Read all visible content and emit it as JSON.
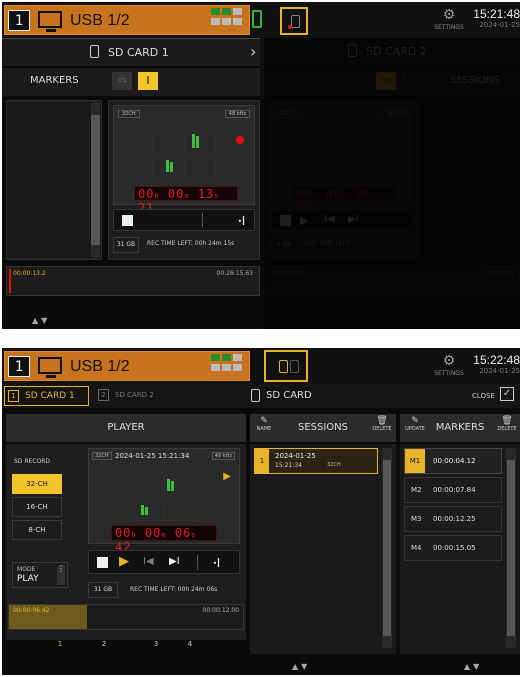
{
  "colors": {
    "accent": "#e7b32b",
    "scene_bar": "#c8741f",
    "record_red": "#e41010",
    "lcd_red": "#e41a1a",
    "meter_green": "#3fbf3f"
  },
  "screen1": {
    "topbar": {
      "scene_number": "1",
      "scene_name": "USB 1/2",
      "settings_label": "SETTINGS",
      "clock_time": "15:21:48",
      "clock_date": "2024-01-25"
    },
    "sd_card_label": "SD CARD 1",
    "sd_card_2_label": "SD CARD 2",
    "markers_label": "MARKERS",
    "sessions_label": "SESSIONS",
    "player": {
      "channels": "32CH",
      "sample_rate": "48 kHz",
      "time_h": "00",
      "time_m": "00",
      "time_s": "13",
      "time_f": "21",
      "capacity": "31 GB",
      "rec_time_left": "REC TIME LEFT:",
      "rec_time_value": "00h 24m 15s"
    },
    "ghost_player": {
      "channels": "32CH",
      "sample_rate": "48 kHz",
      "time_h": "00",
      "time_m": "00",
      "time_s": "00",
      "time_f": "00",
      "capacity": "0 GB",
      "rec_time_left": "REC TIME LEFT:",
      "rec_time_value": "-"
    },
    "timeline": {
      "start": "00:00:13.2",
      "end": "00:26:15.63"
    },
    "ghost_timeline": {
      "start": "00:00:00",
      "end": "00:00:00"
    },
    "scroll_arrows": "▲▼"
  },
  "screen2": {
    "topbar": {
      "scene_number": "1",
      "scene_name": "USB 1/2",
      "settings_label": "SETTINGS",
      "clock_time": "15:22:48",
      "clock_date": "2024-01-25"
    },
    "tabs": [
      {
        "num": "1",
        "label": "SD CARD 1"
      },
      {
        "num": "2",
        "label": "SD CARD 2"
      }
    ],
    "sd_card_title": "SD CARD",
    "close_label": "CLOSE",
    "player": {
      "title": "PLAYER",
      "sd_record_label": "SD RECORD",
      "record_options": [
        "32-CH",
        "16-CH",
        "8-CH"
      ],
      "mode_label": "MODE",
      "mode_value": "PLAY",
      "session_channels": "32CH",
      "session_name": "2024-01-25 15:21:34",
      "sample_rate": "48 kHz",
      "time_h": "00",
      "time_m": "00",
      "time_s": "06",
      "time_f": "42",
      "capacity": "31 GB",
      "rec_time_left": "REC TIME LEFT:",
      "rec_time_value": "00h 24m 06s",
      "timeline_start": "00:00:06.42",
      "timeline_end": "00:00:12.00",
      "marker_numbers": [
        "1",
        "2",
        "3",
        "4"
      ]
    },
    "sessions": {
      "title": "SESSIONS",
      "name_label": "NAME",
      "delete_label": "DELETE",
      "items": [
        {
          "index": "1",
          "date": "2024-01-25",
          "time": "15:21:34",
          "channels": "32CH"
        }
      ]
    },
    "markers": {
      "title": "MARKERS",
      "update_label": "UPDATE",
      "delete_label": "DELETE",
      "items": [
        {
          "id": "M1",
          "time": "00:00:04.12"
        },
        {
          "id": "M2",
          "time": "00:00:07.84"
        },
        {
          "id": "M3",
          "time": "00:00:12.25"
        },
        {
          "id": "M4",
          "time": "00:00:15.05"
        }
      ]
    },
    "scroll_arrows": "▲▼"
  }
}
